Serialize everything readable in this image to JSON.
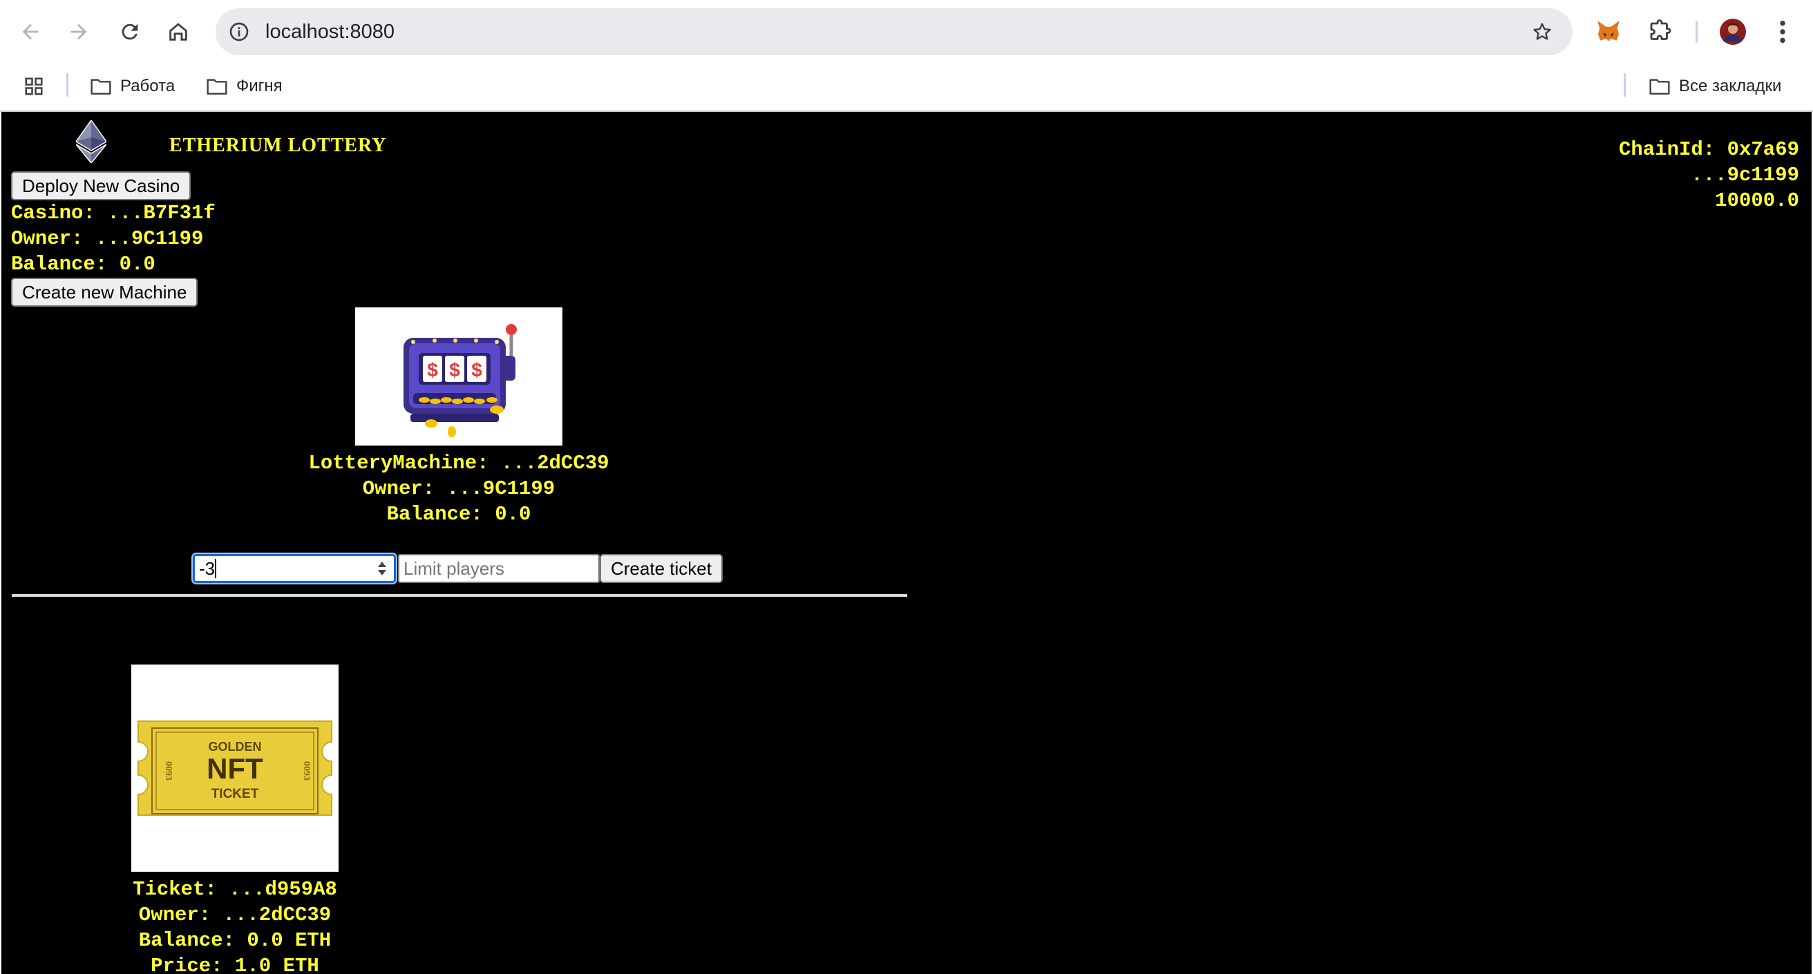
{
  "browser": {
    "url": "localhost:8080",
    "bookmarks": [
      "Работа",
      "Фигня"
    ],
    "all_bookmarks_label": "Все закладки"
  },
  "app": {
    "title": "ETHERIUM LOTTERY",
    "deploy_button": "Deploy New Casino",
    "casino_line": "Casino: ...B7F31f",
    "owner_line": "Owner: ...9C1199",
    "balance_line": "Balance: 0.0",
    "create_machine_button": "Create new Machine"
  },
  "chain": {
    "chain_id_line": "ChainId: 0x7a69",
    "account": "...9c1199",
    "balance": "10000.0"
  },
  "machine": {
    "name_line": "LotteryMachine: ...2dCC39",
    "owner_line": "Owner: ...9C1199",
    "balance_line": "Balance: 0.0",
    "number_input_value": "-3",
    "limit_placeholder": "Limit players",
    "create_ticket_button": "Create ticket",
    "slot_symbols": [
      "$",
      "$",
      "$"
    ]
  },
  "ticket": {
    "image_text": {
      "top": "GOLDEN",
      "main": "NFT",
      "bottom": "TICKET",
      "serial": "0093"
    },
    "ticket_line": "Ticket: ...d959A8",
    "owner_line": "Owner: ...2dCC39",
    "balance_line": "Balance: 0.0 ETH",
    "price_line": "Price: 1.0 ETH"
  },
  "colors": {
    "page_background": "#000000",
    "text_accent": "#ffff33",
    "ticket_gold": "#e9cc3a"
  }
}
